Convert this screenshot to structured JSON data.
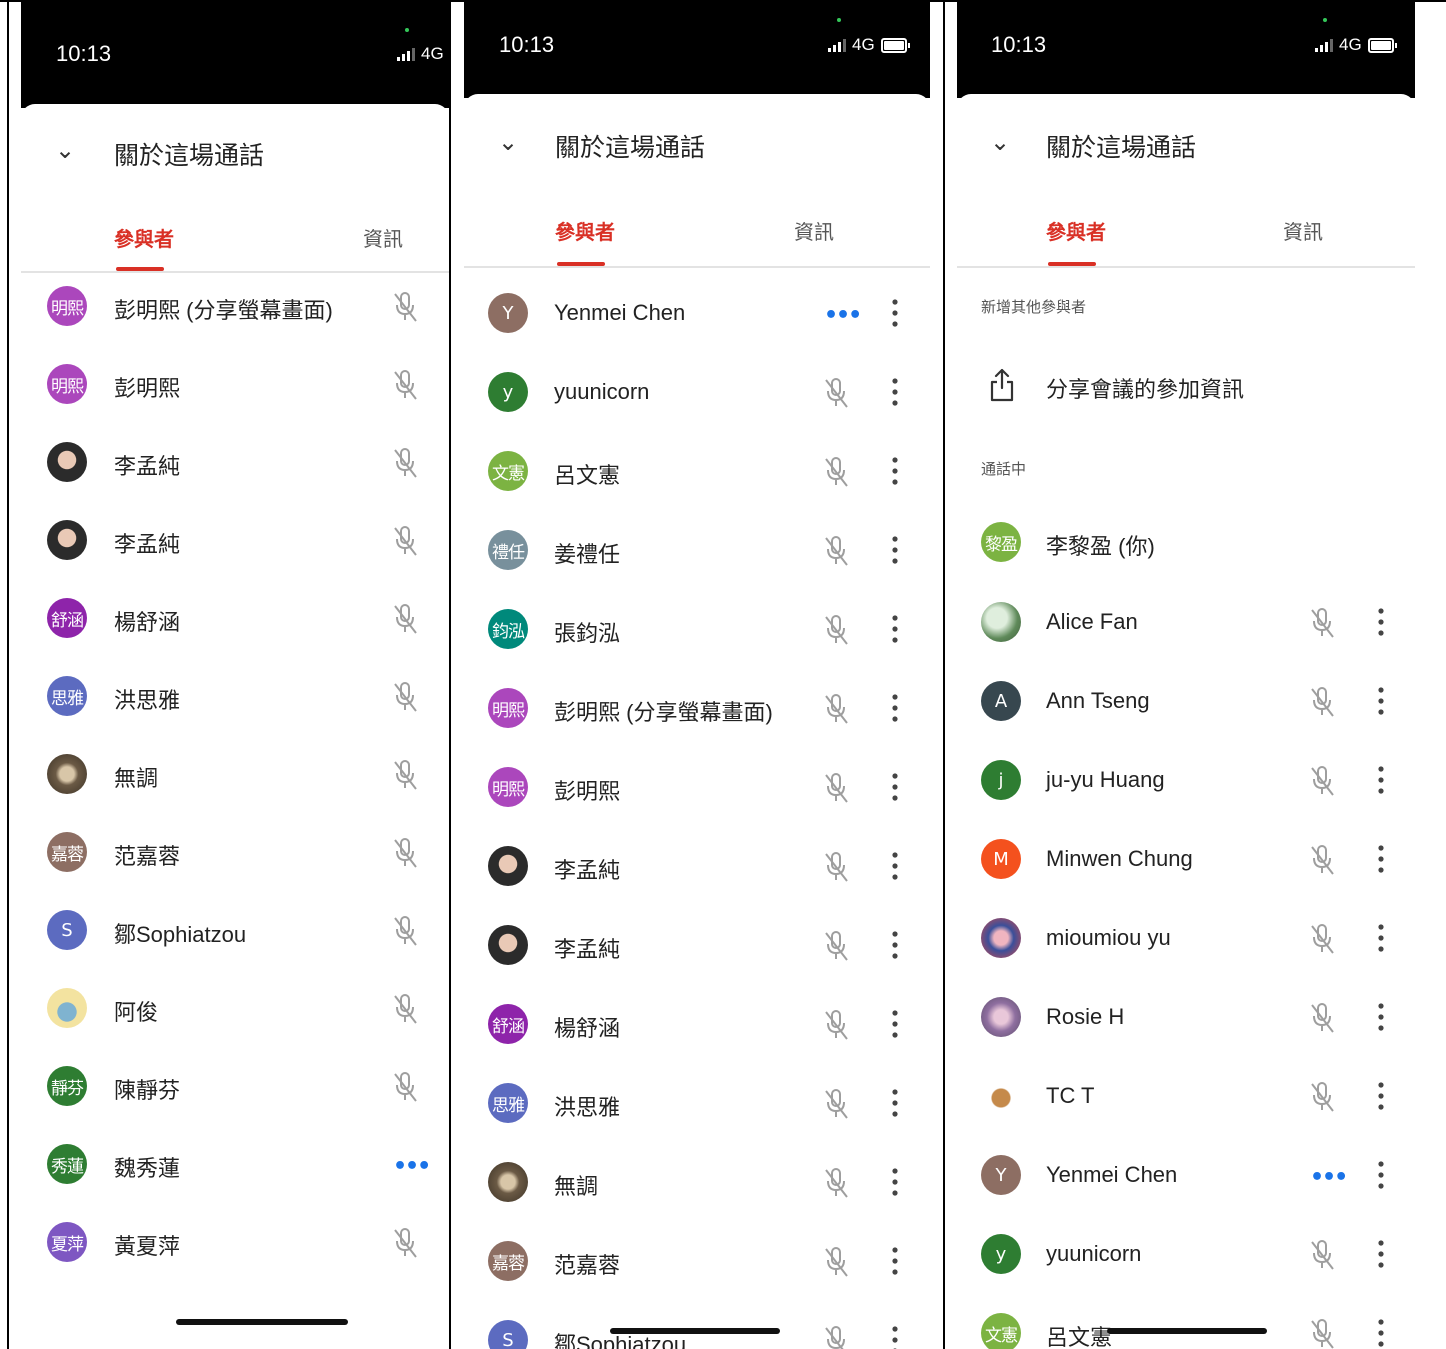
{
  "panels": [
    {
      "time": "10:13",
      "network": "4G",
      "header_title": "關於這場通話",
      "tab_participants": "參與者",
      "tab_info": "資訊",
      "participants": [
        {
          "avatar_text": "明熙",
          "avatar_color": "#ab47bc",
          "name": "彭明熙 (分享螢幕畫面)",
          "status": "muted"
        },
        {
          "avatar_text": "明熙",
          "avatar_color": "#ab47bc",
          "name": "彭明熙",
          "status": "muted"
        },
        {
          "avatar_text": "",
          "avatar_style": "photo",
          "name": "李孟純",
          "status": "muted"
        },
        {
          "avatar_text": "",
          "avatar_style": "photo",
          "name": "李孟純",
          "status": "muted"
        },
        {
          "avatar_text": "舒涵",
          "avatar_color": "#8e24aa",
          "name": "楊舒涵",
          "status": "muted"
        },
        {
          "avatar_text": "思雅",
          "avatar_color": "#5c6bc0",
          "name": "洪思雅",
          "status": "muted"
        },
        {
          "avatar_text": "",
          "avatar_style": "photo2",
          "name": "無調",
          "status": "muted"
        },
        {
          "avatar_text": "嘉蓉",
          "avatar_color": "#8d6e63",
          "name": "范嘉蓉",
          "status": "muted"
        },
        {
          "avatar_text": "S",
          "avatar_color": "#5c6bc0",
          "name": "鄒Sophiatzou",
          "status": "muted"
        },
        {
          "avatar_text": "",
          "avatar_style": "photo3",
          "name": "阿俊",
          "status": "muted"
        },
        {
          "avatar_text": "靜芬",
          "avatar_color": "#2e7d32",
          "name": "陳靜芬",
          "status": "muted"
        },
        {
          "avatar_text": "秀蓮",
          "avatar_color": "#2e7d32",
          "name": "魏秀蓮",
          "status": "speaking"
        },
        {
          "avatar_text": "夏萍",
          "avatar_color": "#7e57c2",
          "name": "黃夏萍",
          "status": "muted"
        }
      ]
    },
    {
      "time": "10:13",
      "network": "4G",
      "header_title": "關於這場通話",
      "tab_participants": "參與者",
      "tab_info": "資訊",
      "participants": [
        {
          "avatar_text": "Y",
          "avatar_color": "#8d6e63",
          "name": "Yenmei Chen",
          "status": "speaking"
        },
        {
          "avatar_text": "y",
          "avatar_color": "#2e7d32",
          "name": "yuunicorn",
          "status": "muted"
        },
        {
          "avatar_text": "文憲",
          "avatar_color": "#7cb342",
          "name": "呂文憲",
          "status": "muted"
        },
        {
          "avatar_text": "禮任",
          "avatar_color": "#78909c",
          "name": "姜禮任",
          "status": "muted"
        },
        {
          "avatar_text": "鈞泓",
          "avatar_color": "#00897b",
          "name": "張鈞泓",
          "status": "muted"
        },
        {
          "avatar_text": "明熙",
          "avatar_color": "#ab47bc",
          "name": "彭明熙 (分享螢幕畫面)",
          "status": "muted"
        },
        {
          "avatar_text": "明熙",
          "avatar_color": "#ab47bc",
          "name": "彭明熙",
          "status": "muted"
        },
        {
          "avatar_text": "",
          "avatar_style": "photo",
          "name": "李孟純",
          "status": "muted"
        },
        {
          "avatar_text": "",
          "avatar_style": "photo",
          "name": "李孟純",
          "status": "muted"
        },
        {
          "avatar_text": "舒涵",
          "avatar_color": "#8e24aa",
          "name": "楊舒涵",
          "status": "muted"
        },
        {
          "avatar_text": "思雅",
          "avatar_color": "#5c6bc0",
          "name": "洪思雅",
          "status": "muted"
        },
        {
          "avatar_text": "",
          "avatar_style": "photo2",
          "name": "無調",
          "status": "muted"
        },
        {
          "avatar_text": "嘉蓉",
          "avatar_color": "#8d6e63",
          "name": "范嘉蓉",
          "status": "muted"
        },
        {
          "avatar_text": "S",
          "avatar_color": "#5c6bc0",
          "name": "鄒Sophiatzou",
          "status": "muted"
        }
      ]
    },
    {
      "time": "10:13",
      "network": "4G",
      "header_title": "關於這場通話",
      "tab_participants": "參與者",
      "tab_info": "資訊",
      "add_section_label": "新增其他參與者",
      "share_label": "分享會議的參加資訊",
      "in_call_label": "通話中",
      "self_participant": {
        "avatar_text": "黎盈",
        "avatar_color": "#7cb342",
        "name": "李黎盈 (你)"
      },
      "participants": [
        {
          "avatar_text": "",
          "avatar_style": "photo4",
          "name": "Alice Fan",
          "status": "muted"
        },
        {
          "avatar_text": "A",
          "avatar_color": "#37474f",
          "name": "Ann Tseng",
          "status": "muted"
        },
        {
          "avatar_text": "j",
          "avatar_color": "#2e7d32",
          "name": "ju-yu Huang",
          "status": "muted"
        },
        {
          "avatar_text": "M",
          "avatar_color": "#f4511e",
          "name": "Minwen Chung",
          "status": "muted"
        },
        {
          "avatar_text": "",
          "avatar_style": "photo5",
          "name": "mioumiou yu",
          "status": "muted"
        },
        {
          "avatar_text": "",
          "avatar_style": "photo6",
          "name": "Rosie H",
          "status": "muted"
        },
        {
          "avatar_text": "",
          "avatar_style": "photo7",
          "name": "TC T",
          "status": "muted"
        },
        {
          "avatar_text": "Y",
          "avatar_color": "#8d6e63",
          "name": "Yenmei Chen",
          "status": "speaking"
        },
        {
          "avatar_text": "y",
          "avatar_color": "#2e7d32",
          "name": "yuunicorn",
          "status": "muted"
        },
        {
          "avatar_text": "文憲",
          "avatar_color": "#7cb342",
          "name": "呂文憲",
          "status": "muted"
        }
      ]
    }
  ]
}
